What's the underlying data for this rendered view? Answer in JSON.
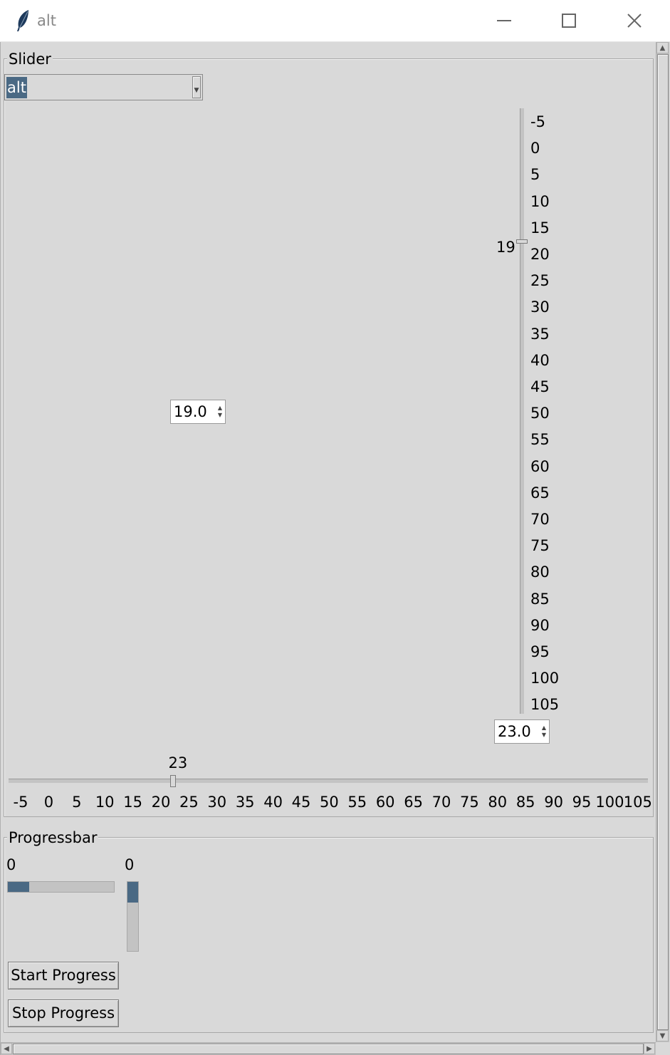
{
  "window": {
    "title": "alt",
    "icons": {
      "app": "feather-icon",
      "minimize": "minimize-icon",
      "maximize": "maximize-icon",
      "close": "close-icon"
    }
  },
  "slider_frame": {
    "label": "Slider",
    "theme_select": {
      "value": "alt"
    },
    "vertical_scale": {
      "value": 19,
      "value_label": "19",
      "ticks": [
        "-5",
        "0",
        "5",
        "10",
        "15",
        "20",
        "25",
        "30",
        "35",
        "40",
        "45",
        "50",
        "55",
        "60",
        "65",
        "70",
        "75",
        "80",
        "85",
        "90",
        "95",
        "100",
        "105"
      ],
      "spinbox_value": "23.0"
    },
    "left_spinbox_value": "19.0",
    "horizontal_scale": {
      "value": 23,
      "value_label": "23",
      "ticks": [
        "-5",
        "0",
        "5",
        "10",
        "15",
        "20",
        "25",
        "30",
        "35",
        "40",
        "45",
        "50",
        "55",
        "60",
        "65",
        "70",
        "75",
        "80",
        "85",
        "90",
        "95",
        "100",
        "105"
      ]
    }
  },
  "progress_frame": {
    "label": "Progressbar",
    "horizontal": {
      "label": "0",
      "fill_fraction": 0.2
    },
    "vertical": {
      "label": "0",
      "fill_fraction": 0.3
    },
    "start_button": "Start Progress",
    "stop_button": "Stop Progress"
  },
  "colors": {
    "accent": "#4a6984",
    "background": "#d9d9d9",
    "trough": "#c3c3c3"
  }
}
